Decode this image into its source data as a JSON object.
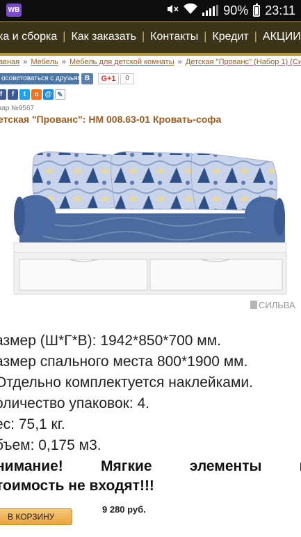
{
  "statusbar": {
    "app_badge": "WB",
    "battery": "90%",
    "time": "23:11"
  },
  "nav": {
    "items": [
      "ка и сборка",
      "Как заказать",
      "Контакты",
      "Кредит",
      "АКЦИИ"
    ]
  },
  "breadcrumb": {
    "items": [
      "авная",
      "Мебель",
      "Мебель для детской комнаты",
      "Детская \"Прованс\" (Набор 1) (Сил"
    ],
    "separator": "»"
  },
  "social": {
    "advise_label": "осоветоваться с друзьями",
    "vk_label": "В",
    "gplus_label": "G+1",
    "gplus_count": "0"
  },
  "product": {
    "sku": "вар №9567",
    "title": "етская \"Прованс\": НМ 008.63-01 Кровать-софа",
    "brand_watermark": "СИЛЬВА"
  },
  "specs": [
    "азмер (Ш*Г*В): 1942*850*700 мм.",
    "азмер спального места 800*1900 мм.",
    "Отдельно комплектуется наклейками.",
    "оличество упаковок: 4.",
    "ес: 75,1 кг.",
    "бъем: 0,175 м3."
  ],
  "warning": {
    "words": [
      "нимание!",
      "Мягкие",
      "элементы",
      "кр"
    ],
    "line2": "тоимость не входят!!!"
  },
  "cart": {
    "button_label": "В КОРЗИНУ",
    "price": "9 280 руб."
  },
  "colors": {
    "nav_bg": "#3b3418",
    "nav_accent": "#b29a3d",
    "link": "#9a5d1c",
    "cart": "#e9a540"
  }
}
